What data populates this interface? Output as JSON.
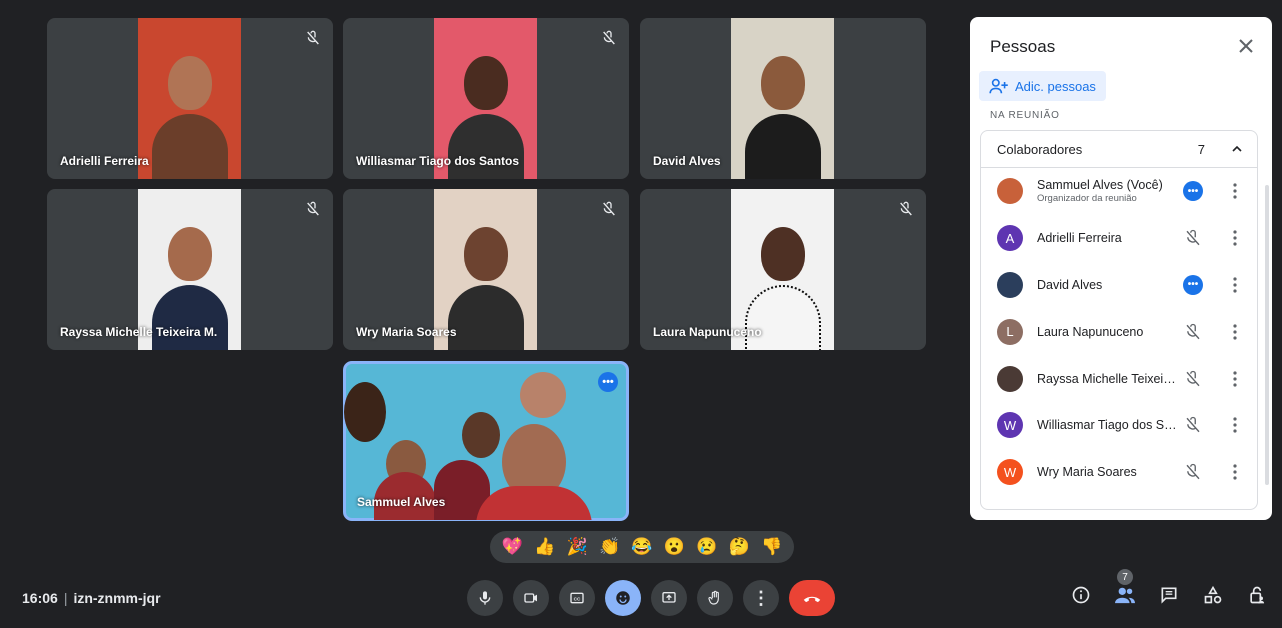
{
  "meeting": {
    "time": "16:06",
    "separator": "|",
    "code": "izn-znmm-jqr"
  },
  "tiles": [
    {
      "name": "Adrielli Ferreira",
      "bg": "#c9472f"
    },
    {
      "name": "Williasmar Tiago dos Santos",
      "bg": "#e3596a"
    },
    {
      "name": "David Alves",
      "bg": "#d8d3c6"
    },
    {
      "name": "Rayssa Michelle Teixeira M.",
      "bg": "#eeeeee"
    },
    {
      "name": "Wry Maria Soares",
      "bg": "#e2d2c4"
    },
    {
      "name": "Laura Napunuceno",
      "bg": "#f2f2f2"
    }
  ],
  "self_tile": {
    "name": "Sammuel Alves",
    "more": "•••"
  },
  "reactions": [
    {
      "name": "sparkling-heart",
      "glyph": "💖"
    },
    {
      "name": "thumbs-up",
      "glyph": "👍"
    },
    {
      "name": "party-popper",
      "glyph": "🎉"
    },
    {
      "name": "clapping-hands",
      "glyph": "👏"
    },
    {
      "name": "tears-of-joy",
      "glyph": "😂"
    },
    {
      "name": "surprised-face",
      "glyph": "😮"
    },
    {
      "name": "crying-face",
      "glyph": "😢"
    },
    {
      "name": "thinking-face",
      "glyph": "🤔"
    },
    {
      "name": "thumbs-down",
      "glyph": "👎"
    }
  ],
  "panel": {
    "title": "Pessoas",
    "close": "✕",
    "add_label": "Adic. pessoas",
    "section_label": "NA REUNIÃO",
    "group_label": "Colaboradores",
    "group_count": "7",
    "participants": [
      {
        "name": "Sammuel Alves (Você)",
        "role": "Organizador da reunião",
        "initial": "",
        "color": "#c8613a",
        "status": "more"
      },
      {
        "name": "Adrielli Ferreira",
        "role": "",
        "initial": "A",
        "color": "#5e35b1",
        "status": "muted"
      },
      {
        "name": "David Alves",
        "role": "",
        "initial": "",
        "color": "#2b3e5c",
        "status": "more"
      },
      {
        "name": "Laura Napunuceno",
        "role": "",
        "initial": "L",
        "color": "#8d6e63",
        "status": "muted"
      },
      {
        "name": "Rayssa Michelle Teixeira ...",
        "role": "",
        "initial": "",
        "color": "#4a3a35",
        "status": "muted"
      },
      {
        "name": "Williasmar Tiago dos Sa...",
        "role": "",
        "initial": "W",
        "color": "#5e35b1",
        "status": "muted"
      },
      {
        "name": "Wry Maria Soares",
        "role": "",
        "initial": "W",
        "color": "#f4511e",
        "status": "muted"
      }
    ]
  },
  "toolbar": {
    "participant_count": "7",
    "more": "⋮"
  }
}
